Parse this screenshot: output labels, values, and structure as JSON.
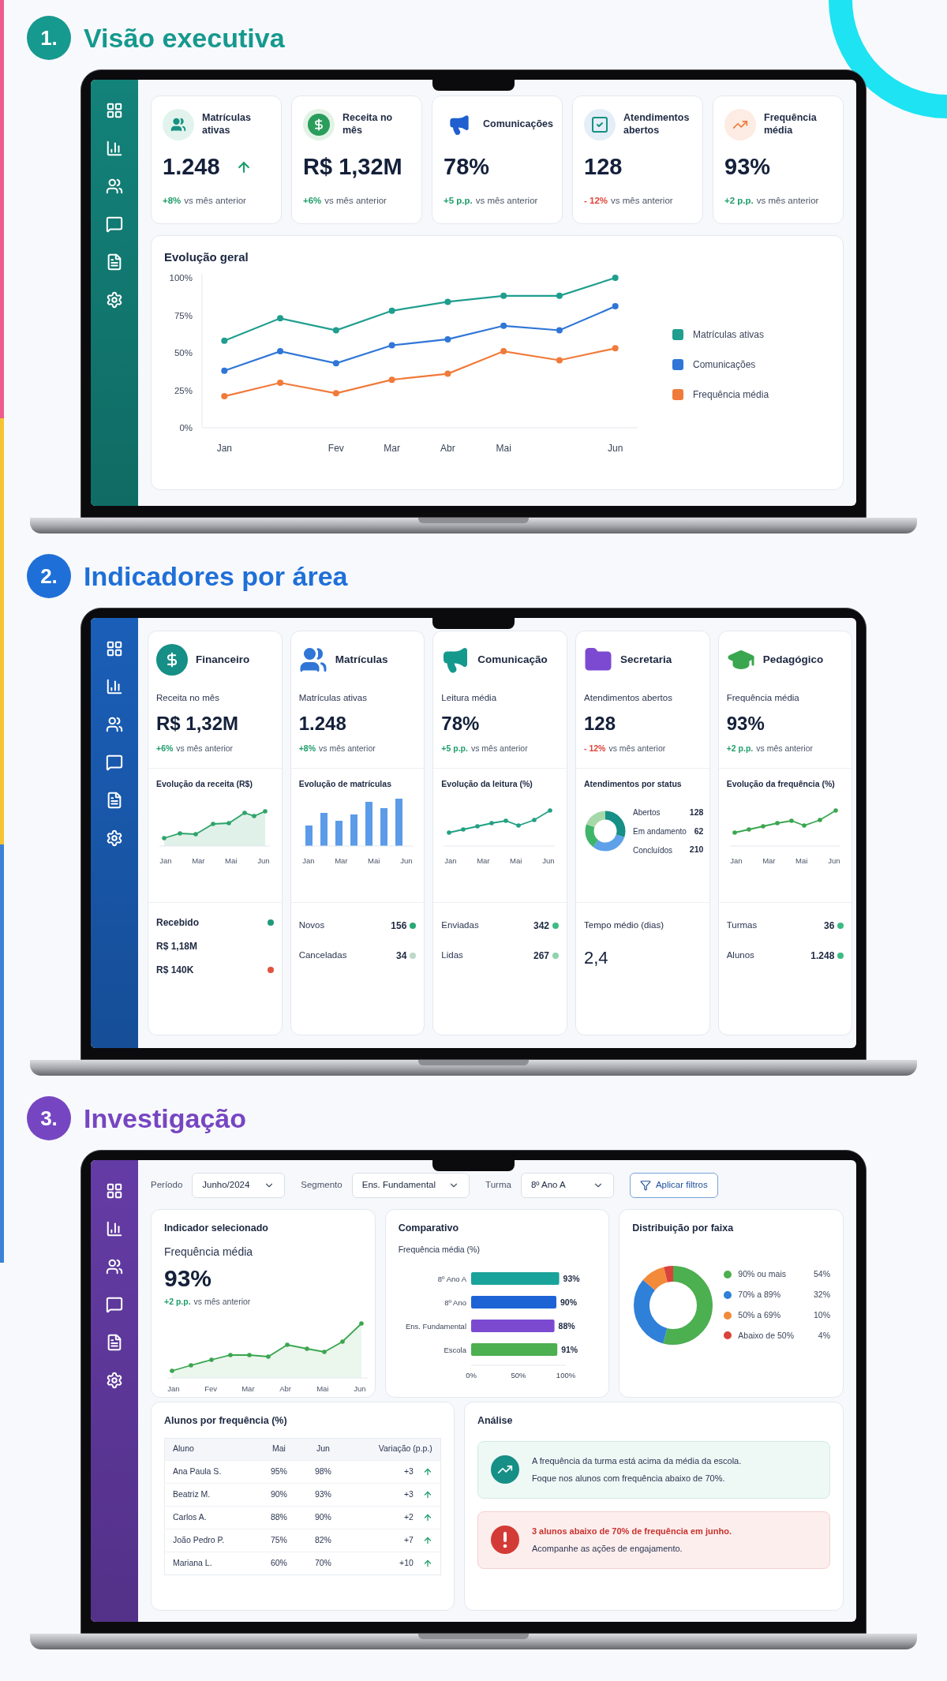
{
  "sections": [
    {
      "number": "1.",
      "title": "Visão executiva",
      "color": "#16998f"
    },
    {
      "number": "2.",
      "title": "Indicadores por área",
      "color": "#1f6fd8"
    },
    {
      "number": "3.",
      "title": "Investigação",
      "color": "#7646c2"
    }
  ],
  "executive": {
    "kpis": [
      {
        "kind": "users",
        "label": "Matrículas ativas",
        "value": "1.248",
        "trend_icon": true,
        "delta": "+8%",
        "negative": false,
        "note": "vs mês anterior"
      },
      {
        "kind": "dollar",
        "label": "Receita no mês",
        "value": "R$ 1,32M",
        "trend_icon": false,
        "delta": "+6%",
        "negative": false,
        "note": "vs mês anterior"
      },
      {
        "kind": "megaphone",
        "label": "Comunicações",
        "value": "78%",
        "trend_icon": false,
        "delta": "+5 p.p.",
        "negative": false,
        "note": "vs mês anterior"
      },
      {
        "kind": "check",
        "label": "Atendimentos abertos",
        "value": "128",
        "trend_icon": false,
        "delta": "- 12%",
        "negative": true,
        "note": "vs mês anterior"
      },
      {
        "kind": "trend",
        "label": "Frequência média",
        "value": "93%",
        "trend_icon": false,
        "delta": "+2 p.p.",
        "negative": false,
        "note": "vs mês anterior"
      }
    ],
    "chart": {
      "chart_data": {
        "type": "line",
        "title": "Evolução geral",
        "legend": "right",
        "categories": [
          "Jan",
          null,
          "Fev",
          "Mar",
          "Abr",
          "Mai",
          null,
          "Jun"
        ],
        "ylim": [
          0,
          100
        ],
        "yticks": [
          {
            "value": 0,
            "label": "0%"
          },
          {
            "value": 25,
            "label": "25%"
          },
          {
            "value": 50,
            "label": "50%"
          },
          {
            "value": 75,
            "label": "75%"
          },
          {
            "value": 100,
            "label": "100%"
          }
        ],
        "series": [
          {
            "name": "Matrículas ativas",
            "color": "#1f9e8e",
            "marker": "circle",
            "values": [
              58,
              73,
              65,
              78,
              84,
              88,
              88,
              100
            ]
          },
          {
            "name": "Comunicações",
            "color": "#2f76d6",
            "marker": "circle",
            "values": [
              38,
              51,
              43,
              55,
              59,
              68,
              65,
              81
            ]
          },
          {
            "name": "Frequência média",
            "color": "#f07a3a",
            "marker": "circle",
            "values": [
              21,
              30,
              23,
              32,
              36,
              51,
              45,
              53
            ]
          }
        ]
      }
    }
  },
  "areas": {
    "cards": [
      {
        "kind": "dollar",
        "title": "Financeiro",
        "metric_label": "Receita no mês",
        "value": "R$ 1,32M",
        "delta": "+6%",
        "negative": false,
        "note": "vs mês anterior",
        "chart_title": "Evolução da receita (R$)",
        "mini_chart": {
          "kind": "area",
          "color": "#2fa36b",
          "x_labels": [
            "Jan",
            "Mar",
            "Mai",
            "Jun"
          ]
        },
        "footer": {
          "kind": "stack",
          "items": [
            {
              "text": "Recebido",
              "color": "#1e9a7a"
            },
            {
              "text": "R$ 1,18M"
            },
            {
              "text": "R$ 140K",
              "color": "#e0533d"
            }
          ]
        }
      },
      {
        "kind": "users",
        "title": "Matrículas",
        "metric_label": "Matrículas ativas",
        "value": "1.248",
        "delta": "+8%",
        "negative": false,
        "note": "vs mês anterior",
        "chart_title": "Evolução de matrículas",
        "mini_chart": {
          "kind": "bar",
          "color": "#5b9be8",
          "x_labels": [
            "Jan",
            "Mar",
            "Mai",
            "Jun"
          ]
        },
        "footer": {
          "kind": "rows",
          "items": [
            {
              "label": "Novos",
              "value": "156",
              "color": "#2aa876"
            },
            {
              "label": "Canceladas",
              "value": "34",
              "color": "#bcd9c9"
            }
          ]
        }
      },
      {
        "kind": "megaphone",
        "title": "Comunicação",
        "metric_label": "Leitura média",
        "value": "78%",
        "delta": "+5 p.p.",
        "negative": false,
        "note": "vs mês anterior",
        "chart_title": "Evolução da leitura (%)",
        "mini_chart": {
          "kind": "line",
          "color": "#23a083",
          "x_labels": [
            "Jan",
            "Mar",
            "Mai",
            "Jun"
          ]
        },
        "footer": {
          "kind": "rows",
          "items": [
            {
              "label": "Enviadas",
              "value": "342",
              "color": "#3dbb84"
            },
            {
              "label": "Lidas",
              "value": "267",
              "color": "#8fd3ae"
            }
          ]
        }
      },
      {
        "kind": "folder",
        "title": "Secretaria",
        "metric_label": "Atendimentos abertos",
        "value": "128",
        "delta": "- 12%",
        "negative": true,
        "note": "vs mês anterior",
        "chart_title": "Atendimentos por status",
        "mini_chart": {
          "kind": "donut",
          "legend": [
            {
              "label": "Abertos",
              "value": "128"
            },
            {
              "label": "Em andamento",
              "value": "62"
            },
            {
              "label": "Concluídos",
              "value": "210"
            }
          ]
        },
        "footer": {
          "kind": "big",
          "label": "Tempo médio (dias)",
          "value": "2,4"
        }
      },
      {
        "kind": "graduation",
        "title": "Pedagógico",
        "metric_label": "Frequência média",
        "value": "93%",
        "delta": "+2 p.p.",
        "negative": false,
        "note": "vs mês anterior",
        "chart_title": "Evolução da frequência (%)",
        "mini_chart": {
          "kind": "line",
          "color": "#3aa64f",
          "x_labels": [
            "Jan",
            "Mar",
            "Mai",
            "Jun"
          ]
        },
        "footer": {
          "kind": "rows",
          "items": [
            {
              "label": "Turmas",
              "value": "36",
              "color": "#3dbb84"
            },
            {
              "label": "Alunos",
              "value": "1.248",
              "color": "#3dbb84"
            }
          ]
        }
      }
    ]
  },
  "investigation": {
    "filters": [
      {
        "label": "Período",
        "value": "Junho/2024"
      },
      {
        "label": "Segmento",
        "value": "Ens. Fundamental"
      },
      {
        "label": "Turma",
        "value": "8º Ano A"
      }
    ],
    "apply_button": "Aplicar filtros",
    "indicator": {
      "title": "Indicador selecionado",
      "metric_label": "Frequência média",
      "value": "93%",
      "delta": "+2 p.p.",
      "negative": false,
      "note": "vs mês anterior",
      "x_labels": [
        "Jan",
        "Fev",
        "Mar",
        "Abr",
        "Mai",
        "Jun"
      ]
    },
    "comparison": {
      "title": "Comparativo",
      "chart_data": {
        "type": "bar",
        "orientation": "horizontal",
        "title": "Frequência média (%)",
        "categories": [
          "8º Ano A",
          "8º Ano",
          "Ens. Fundamental",
          "Escola"
        ],
        "series": [
          {
            "values": [
              93,
              90,
              88,
              91
            ]
          }
        ],
        "colors": [
          "#1aa39a",
          "#1d63d6",
          "#7c4ad1",
          "#4caf50"
        ],
        "xlim": [
          0,
          100
        ],
        "xticks": [
          {
            "value": 0,
            "label": "0%"
          },
          {
            "value": 50,
            "label": "50%"
          },
          {
            "value": 100,
            "label": "100%"
          }
        ],
        "value_labels": [
          "93%",
          "90%",
          "88%",
          "91%"
        ]
      }
    },
    "distribution": {
      "title": "Distribuição por faixa",
      "chart_data": {
        "type": "donut",
        "legend": "right",
        "categories": [
          "90% ou mais",
          "70% a 89%",
          "50% a 69%",
          "Abaixo de 50%"
        ],
        "values": [
          54,
          32,
          10,
          4
        ],
        "value_labels": [
          "54%",
          "32%",
          "10%",
          "4%"
        ],
        "colors": [
          "#4caf50",
          "#2f80d8",
          "#f28a3a",
          "#d9433b"
        ]
      }
    },
    "students": {
      "title": "Alunos por frequência (%)",
      "columns": [
        "Aluno",
        "Mai",
        "Jun",
        "Variação (p.p.)"
      ],
      "rows": [
        {
          "cells": [
            "Ana Paula S.",
            "95%",
            "98%",
            "+3"
          ],
          "up": true
        },
        {
          "cells": [
            "Beatriz M.",
            "90%",
            "93%",
            "+3"
          ],
          "up": true
        },
        {
          "cells": [
            "Carlos A.",
            "88%",
            "90%",
            "+2"
          ],
          "up": true
        },
        {
          "cells": [
            "João Pedro P.",
            "75%",
            "82%",
            "+7"
          ],
          "up": true
        },
        {
          "cells": [
            "Mariana L.",
            "60%",
            "70%",
            "+10"
          ],
          "up": true
        }
      ]
    },
    "analysis": {
      "title": "Análise",
      "alerts": [
        {
          "warning": false,
          "lines": [
            "A frequência da turma está acima da média da escola.",
            "Foque nos alunos com frequência abaixo de 70%."
          ]
        },
        {
          "warning": true,
          "lines": [
            "3 alunos abaixo de 70% de frequência em junho.",
            "Acompanhe as ações de engajamento."
          ]
        }
      ]
    }
  }
}
